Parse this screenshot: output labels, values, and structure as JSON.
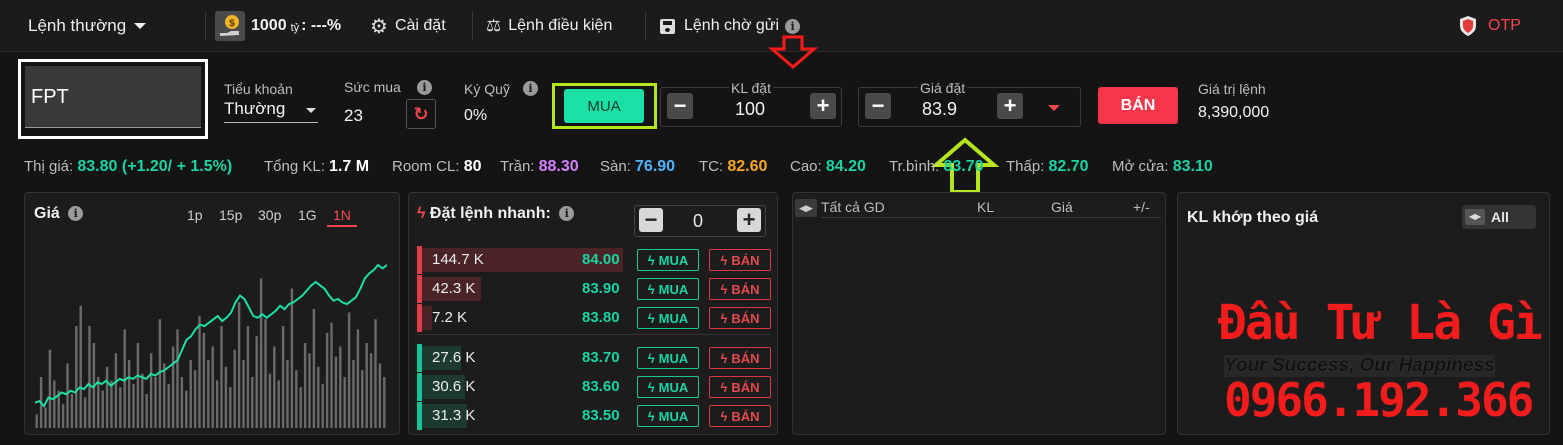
{
  "topbar": {
    "order_type": "Lệnh thường",
    "balance_amount": "1000",
    "balance_unit": "tỷ",
    "balance_suffix": ": ---%",
    "settings": "Cài đặt",
    "conditional": "Lệnh điều kiện",
    "pending": "Lệnh chờ gửi",
    "otp": "OTP"
  },
  "order": {
    "symbol": "FPT",
    "subaccount_label": "Tiểu khoản",
    "subaccount_value": "Thường",
    "buying_power_label": "Sức mua",
    "buying_power_value": "23",
    "margin_label": "Ký Quỹ",
    "margin_value": "0%",
    "buy_label": "MUA",
    "qty_label": "KL đặt",
    "qty_value": "100",
    "price_label": "Giá đặt",
    "price_value": "83.9",
    "sell_label": "BÁN",
    "order_value_label": "Giá trị lệnh",
    "order_value": "8,390,000"
  },
  "ticker": [
    {
      "label": "Thị giá:",
      "value": "83.80 (+1.20/ + 1.5%)",
      "color": "#19d3a2"
    },
    {
      "label": "Tổng KL:",
      "value": "1.7 M",
      "color": "#ffffff"
    },
    {
      "label": "Room CL:",
      "value": "80",
      "color": "#ffffff"
    },
    {
      "label": "Trần:",
      "value": "88.30",
      "color": "#d580ff"
    },
    {
      "label": "Sàn:",
      "value": "76.90",
      "color": "#4fb3ff"
    },
    {
      "label": "TC:",
      "value": "82.60",
      "color": "#f5a623"
    },
    {
      "label": "Cao:",
      "value": "84.20",
      "color": "#19d3a2"
    },
    {
      "label": "Tr.bình:",
      "value": "83.70",
      "color": "#19d3a2"
    },
    {
      "label": "Thấp:",
      "value": "82.70",
      "color": "#19d3a2"
    },
    {
      "label": "Mở cửa:",
      "value": "83.10",
      "color": "#19d3a2"
    }
  ],
  "price_panel": {
    "title": "Giá",
    "ranges": [
      "1p",
      "15p",
      "30p",
      "1G",
      "1N"
    ],
    "active_range": "1N"
  },
  "fast_order": {
    "title": "Đặt lệnh nhanh:",
    "qty": "0",
    "buy": "MUA",
    "sell": "BÁN",
    "asks": [
      {
        "vol": "144.7 K",
        "price": "84.00",
        "fill": 0.98
      },
      {
        "vol": "42.3 K",
        "price": "83.90",
        "fill": 0.29
      },
      {
        "vol": "7.2 K",
        "price": "83.80",
        "fill": 0.05
      }
    ],
    "bids": [
      {
        "vol": "27.6 K",
        "price": "83.70",
        "fill": 0.19
      },
      {
        "vol": "30.6 K",
        "price": "83.60",
        "fill": 0.21
      },
      {
        "vol": "31.3 K",
        "price": "83.50",
        "fill": 0.22
      }
    ]
  },
  "trades_panel": {
    "headers": [
      "Tất cả GD",
      "KL",
      "Giá",
      "+/-"
    ]
  },
  "match_panel": {
    "title": "KL khớp theo giá",
    "filter": "All"
  },
  "watermark": {
    "title": "Đầu Tư Là Gì",
    "slogan": "Your Success, Our Happiness",
    "phone": "0966.192.366"
  },
  "chart_data": {
    "type": "line",
    "title": "",
    "series": [
      {
        "values": [
          49,
          50,
          47,
          52,
          51,
          53,
          55,
          54,
          56,
          55,
          58,
          57,
          60,
          58,
          61,
          60,
          62,
          59,
          61,
          63,
          62,
          64,
          63,
          65,
          64,
          63,
          66,
          65,
          67,
          68,
          70,
          72,
          74,
          80,
          86,
          88,
          92,
          95,
          94,
          96,
          98,
          100,
          97,
          99,
          102,
          108,
          112,
          110,
          105,
          100,
          99,
          101,
          99,
          101,
          103,
          106,
          104,
          107,
          108,
          110,
          112,
          115,
          118,
          120,
          118,
          116,
          112,
          109,
          110,
          108,
          107,
          109,
          111,
          116,
          122,
          125,
          127,
          130,
          128,
          130
        ]
      },
      {
        "values": [
          8,
          30,
          12,
          46,
          28,
          22,
          14,
          38,
          20,
          60,
          72,
          18,
          60,
          50,
          30,
          22,
          36,
          28,
          44,
          24,
          58,
          40,
          26,
          50,
          32,
          20,
          44,
          30,
          64,
          38,
          26,
          48,
          58,
          30,
          22,
          40,
          34,
          66,
          56,
          40,
          48,
          28,
          60,
          36,
          24,
          46,
          74,
          40,
          60,
          30,
          54,
          88,
          64,
          32,
          48,
          28,
          60,
          40,
          82,
          34,
          24,
          50,
          44,
          70,
          36,
          26,
          56,
          62,
          42,
          48,
          30,
          68,
          40,
          58,
          34,
          50,
          44,
          64,
          38,
          30
        ]
      }
    ]
  }
}
